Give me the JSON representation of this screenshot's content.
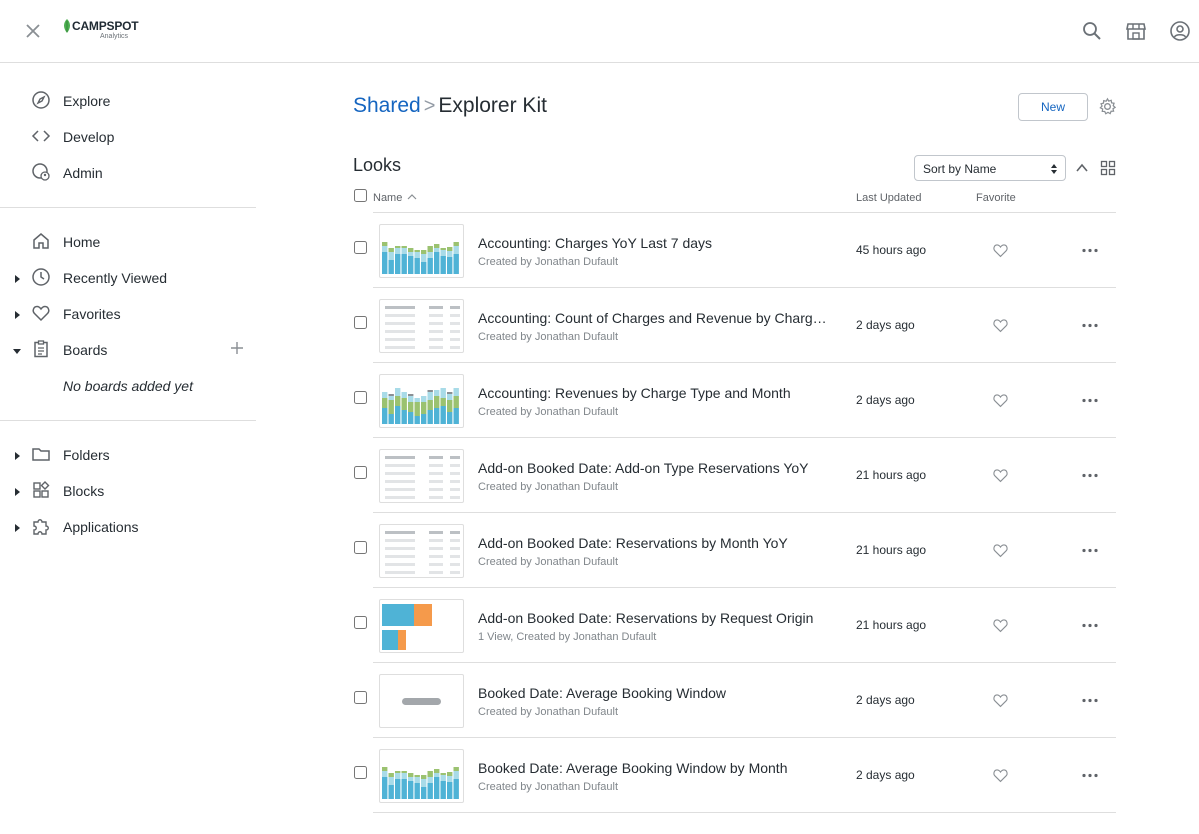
{
  "app": {
    "brand": "CAMPSPOT",
    "brand_sub": "Analytics"
  },
  "colors": {
    "accent": "#1565c0",
    "brand_green": "#4caf50",
    "bar_blue": "#4fb3d6",
    "bar_green": "#9bc270",
    "bar_lightblue": "#a8dbe8",
    "bar_orange": "#f59a4b",
    "bar_gray": "#8a8f94"
  },
  "sidebar": {
    "primary": [
      {
        "label": "Explore",
        "icon": "compass-icon"
      },
      {
        "label": "Develop",
        "icon": "code-icon"
      },
      {
        "label": "Admin",
        "icon": "admin-icon"
      }
    ],
    "secondary": [
      {
        "label": "Home",
        "icon": "home-icon"
      },
      {
        "label": "Recently Viewed",
        "icon": "clock-icon"
      },
      {
        "label": "Favorites",
        "icon": "heart-icon"
      },
      {
        "label": "Boards",
        "icon": "clipboard-icon"
      }
    ],
    "boards_empty": "No boards added yet",
    "tertiary": [
      {
        "label": "Folders",
        "icon": "folder-icon"
      },
      {
        "label": "Blocks",
        "icon": "blocks-icon"
      },
      {
        "label": "Applications",
        "icon": "puzzle-icon"
      }
    ]
  },
  "breadcrumb": {
    "parent": "Shared",
    "separator": ">",
    "current": "Explorer Kit"
  },
  "actions": {
    "new_label": "New"
  },
  "looks": {
    "title": "Looks",
    "sort_value": "Sort by Name",
    "columns": {
      "name": "Name",
      "updated": "Last Updated",
      "favorite": "Favorite"
    },
    "rows": [
      {
        "title": "Accounting: Charges YoY Last 7 days",
        "subtitle": "Created by Jonathan Dufault",
        "updated": "45 hours ago",
        "thumb": "bar"
      },
      {
        "title": "Accounting: Count of Charges and Revenue by Charge Type",
        "subtitle": "Created by Jonathan Dufault",
        "updated": "2 days ago",
        "thumb": "table"
      },
      {
        "title": "Accounting: Revenues by Charge Type and Month",
        "subtitle": "Created by Jonathan Dufault",
        "updated": "2 days ago",
        "thumb": "stacked"
      },
      {
        "title": "Add-on Booked Date: Add-on Type Reservations YoY",
        "subtitle": "Created by Jonathan Dufault",
        "updated": "21 hours ago",
        "thumb": "table"
      },
      {
        "title": "Add-on Booked Date: Reservations by Month YoY",
        "subtitle": "Created by Jonathan Dufault",
        "updated": "21 hours ago",
        "thumb": "table"
      },
      {
        "title": "Add-on Booked Date: Reservations by Request Origin",
        "subtitle": "1 View, Created by Jonathan Dufault",
        "updated": "21 hours ago",
        "thumb": "hbar"
      },
      {
        "title": "Booked Date: Average Booking Window",
        "subtitle": "Created by Jonathan Dufault",
        "updated": "2 days ago",
        "thumb": "single"
      },
      {
        "title": "Booked Date: Average Booking Window by Month",
        "subtitle": "Created by Jonathan Dufault",
        "updated": "2 days ago",
        "thumb": "bar"
      }
    ]
  }
}
